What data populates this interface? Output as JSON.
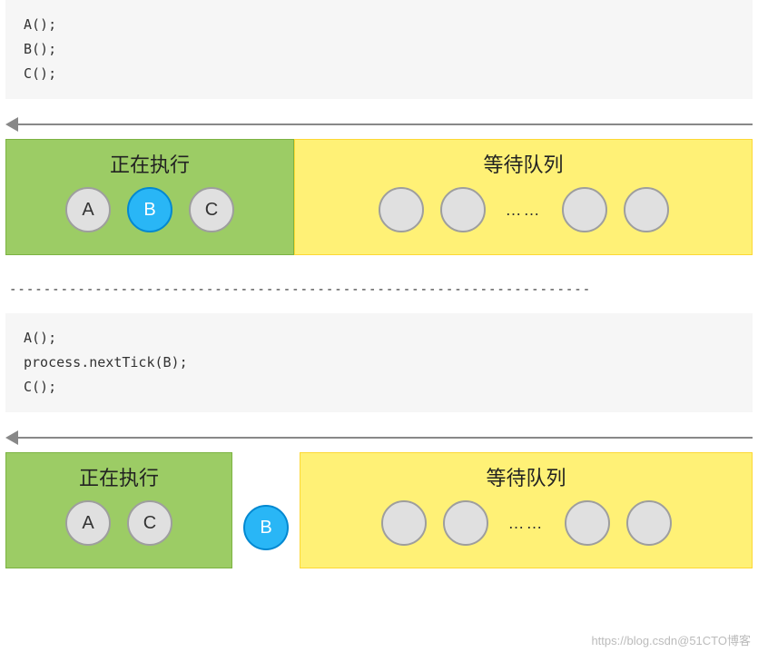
{
  "code1": {
    "line1": "A();",
    "line2": "B();",
    "line3": "C();"
  },
  "diagram1": {
    "exec_title": "正在执行",
    "wait_title": "等待队列",
    "exec_items": {
      "a": "A",
      "b": "B",
      "c": "C"
    },
    "ellipsis": "……"
  },
  "separator_text": "--------------------------------------------------------------------",
  "code2": {
    "line1": "A();",
    "line2": "process.nextTick(B);",
    "line3": "C();"
  },
  "diagram2": {
    "exec_title": "正在执行",
    "wait_title": "等待队列",
    "exec_items": {
      "a": "A",
      "c": "C"
    },
    "between_item": "B",
    "ellipsis": "……"
  },
  "watermark": "https://blog.csdn@51CTO博客",
  "colors": {
    "exec_bg": "#9ccc65",
    "wait_bg": "#fff176",
    "highlight_circle": "#29b6f6",
    "plain_circle": "#e0e0e0"
  }
}
